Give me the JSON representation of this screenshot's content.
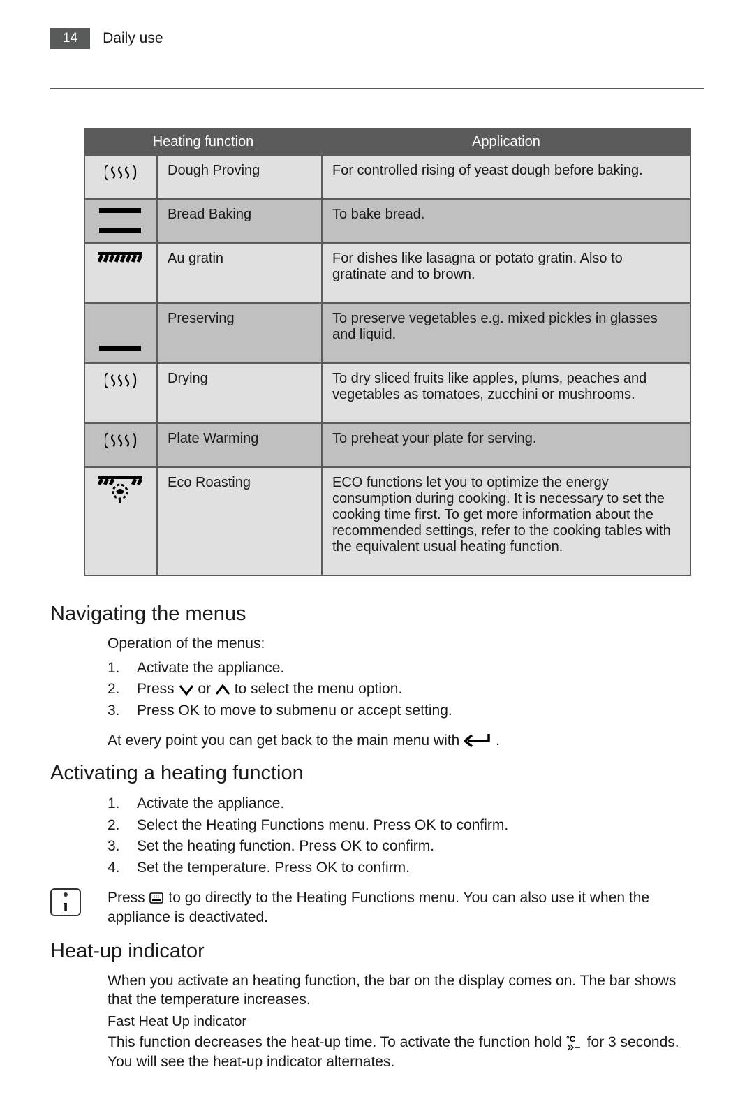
{
  "header": {
    "page_number": "14",
    "section_title": "Daily use"
  },
  "table": {
    "header_left": "Heating function",
    "header_right": "Application",
    "rows": [
      {
        "icon": "steam-in-brackets",
        "name": "Dough Proving",
        "desc": "For controlled rising of yeast dough before baking."
      },
      {
        "icon": "top-bottom-heat",
        "name": "Bread Baking",
        "desc": "To bake bread."
      },
      {
        "icon": "gratin",
        "name": "Au gratin",
        "desc": "For dishes like lasagna or potato gratin. Also to gratinate and to brown."
      },
      {
        "icon": "bottom-heat",
        "name": "Preserving",
        "desc": "To preserve vegetables e.g. mixed pickles in glasses and liquid."
      },
      {
        "icon": "steam-in-brackets",
        "name": "Drying",
        "desc": "To dry sliced fruits like apples, plums, peaches and vegetables as tomatoes, zucchini or mushrooms."
      },
      {
        "icon": "steam-in-brackets",
        "name": "Plate Warming",
        "desc": "To preheat your plate for serving."
      },
      {
        "icon": "eco-roasting",
        "name": "Eco Roasting",
        "desc": "ECO functions let you to optimize the energy consumption during cooking. It is necessary to set the cooking time first. To get more information about the recommended settings, refer to the cooking tables with the equivalent usual heating function."
      }
    ]
  },
  "sections": {
    "navigating": {
      "heading": "Navigating the menus",
      "intro": "Operation of the menus:",
      "steps": [
        {
          "n": "1.",
          "text": "Activate the appliance."
        },
        {
          "n": "2.",
          "text_pre": "Press ",
          "icon1": "chevron-down",
          "text_mid": " or ",
          "icon2": "chevron-up",
          "text_post": " to select the menu option."
        },
        {
          "n": "3.",
          "text": "Press OK to move to submenu or accept setting."
        }
      ],
      "back_note_pre": "At every point you can get back to the main menu with ",
      "back_note_post": " ."
    },
    "activating": {
      "heading": "Activating a heating function",
      "steps": [
        {
          "n": "1.",
          "text": "Activate the appliance."
        },
        {
          "n": "2.",
          "text": "Select the Heating Functions menu. Press OK to confirm."
        },
        {
          "n": "3.",
          "text": "Set the heating function. Press OK to confirm."
        },
        {
          "n": "4.",
          "text": "Set the temperature. Press OK to confirm."
        }
      ],
      "info_pre": "Press ",
      "info_post": " to go directly to the Heating Functions menu. You can also use it when the appliance is deactivated."
    },
    "heatup": {
      "heading": "Heat-up indicator",
      "p1": "When you activate an heating function, the bar on the display comes on. The bar shows that the temperature increases.",
      "subhead": "Fast Heat Up indicator",
      "p2_pre": "This function decreases the heat-up time. To activate the function hold ",
      "p2_post": " for 3 seconds. You will see the heat-up indicator alternates."
    }
  }
}
